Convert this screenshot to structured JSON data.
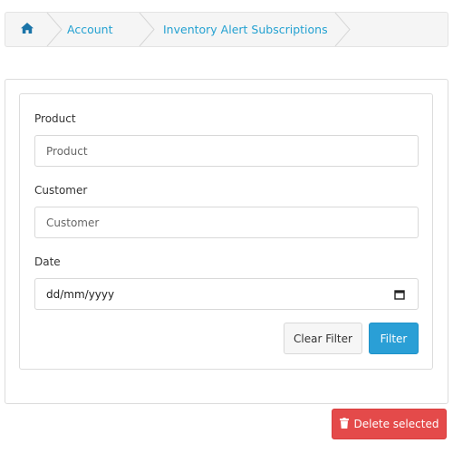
{
  "breadcrumb": {
    "items": [
      {
        "icon": "home-icon",
        "label": ""
      },
      {
        "label": "Account"
      },
      {
        "label": "Inventory Alert Subscriptions"
      }
    ]
  },
  "filter": {
    "product": {
      "label": "Product",
      "placeholder": "Product"
    },
    "customer": {
      "label": "Customer",
      "placeholder": "Customer"
    },
    "date": {
      "label": "Date",
      "placeholder": "dd/mm/yyyy",
      "icon": "calendar-icon"
    },
    "clear_label": "Clear Filter",
    "filter_label": "Filter"
  },
  "actions": {
    "delete_label": "Delete selected",
    "delete_icon": "trash-icon"
  },
  "colors": {
    "link": "#23a1d1",
    "primary": "#2a9fd6",
    "danger": "#e44a4a"
  }
}
